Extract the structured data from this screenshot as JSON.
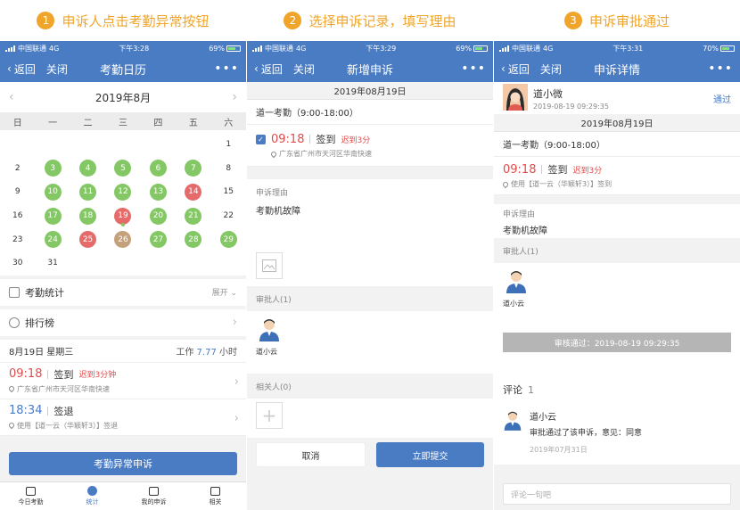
{
  "steps": [
    {
      "num": "1",
      "title": "申诉人点击考勤异常按钮"
    },
    {
      "num": "2",
      "title": "选择申诉记录，填写理由"
    },
    {
      "num": "3",
      "title": "申诉审批通过"
    }
  ],
  "colors": {
    "accent": "#4a7cc4",
    "step": "#f0a52a",
    "late": "#e24b4b",
    "green": "#84c765",
    "red": "#e56b6b",
    "tan": "#c4a07b"
  },
  "status": {
    "carrier": "中国联通",
    "network": "4G",
    "battery1": "69%",
    "battery2": "69%",
    "battery3": "70%",
    "time1": "下午3:28",
    "time2": "下午3:29",
    "time3": "下午3:31"
  },
  "nav": {
    "back": "返回",
    "close": "关闭",
    "more": "•••",
    "title1": "考勤日历",
    "title2": "新增申诉",
    "title3": "申诉详情"
  },
  "calendar": {
    "month": "2019年8月",
    "weekdays": [
      "日",
      "一",
      "二",
      "三",
      "四",
      "五",
      "六"
    ],
    "cells": [
      {
        "d": "",
        "s": ""
      },
      {
        "d": "",
        "s": ""
      },
      {
        "d": "",
        "s": ""
      },
      {
        "d": "",
        "s": ""
      },
      {
        "d": "",
        "s": ""
      },
      {
        "d": "",
        "s": ""
      },
      {
        "d": "1",
        "s": ""
      },
      {
        "d": "2",
        "s": ""
      },
      {
        "d": "3",
        "s": "g"
      },
      {
        "d": "4",
        "s": "g"
      },
      {
        "d": "5",
        "s": "g"
      },
      {
        "d": "6",
        "s": "g"
      },
      {
        "d": "7",
        "s": "g"
      },
      {
        "d": "8",
        "s": ""
      },
      {
        "d": "9",
        "s": ""
      },
      {
        "d": "10",
        "s": "g"
      },
      {
        "d": "11",
        "s": "g"
      },
      {
        "d": "12",
        "s": "g"
      },
      {
        "d": "13",
        "s": "g"
      },
      {
        "d": "14",
        "s": "r"
      },
      {
        "d": "15",
        "s": ""
      },
      {
        "d": "16",
        "s": ""
      },
      {
        "d": "17",
        "s": "g"
      },
      {
        "d": "18",
        "s": "g"
      },
      {
        "d": "19",
        "s": "rs"
      },
      {
        "d": "20",
        "s": "g"
      },
      {
        "d": "21",
        "s": "g"
      },
      {
        "d": "22",
        "s": ""
      },
      {
        "d": "23",
        "s": ""
      },
      {
        "d": "24",
        "s": "g"
      },
      {
        "d": "25",
        "s": "r"
      },
      {
        "d": "26",
        "s": "b"
      },
      {
        "d": "27",
        "s": "g"
      },
      {
        "d": "28",
        "s": "g"
      },
      {
        "d": "29",
        "s": "g"
      },
      {
        "d": "30",
        "s": ""
      },
      {
        "d": "31",
        "s": ""
      }
    ]
  },
  "s1": {
    "stats_label": "考勤统计",
    "expand": "展开",
    "rank_label": "排行榜",
    "date": "8月19日 星期三",
    "work_prefix": "工作",
    "work_hours": "7.77",
    "work_unit": "小时",
    "in_time": "09:18",
    "in_label": "签到",
    "in_status": "迟到3分钟",
    "in_loc": "广东省广州市天河区华南快速",
    "out_time": "18:34",
    "out_label": "签退",
    "out_loc": "使用【道一云（华颖轩3）】签退",
    "button": "考勤异常申诉",
    "tabs": [
      "今日考勤",
      "统计",
      "我的申诉",
      "相关"
    ]
  },
  "s2": {
    "date": "2019年08月19日",
    "shift": "道一考勤（9:00-18:00）",
    "time": "09:18",
    "label": "签到",
    "status": "迟到3分",
    "loc": "广东省广州市天河区华南快速",
    "reason_label": "申诉理由",
    "reason": "考勤机故障",
    "approver_label": "审批人(1)",
    "approver": "道小云",
    "related_label": "相关人(0)",
    "cancel": "取消",
    "submit": "立即提交"
  },
  "s3": {
    "user": "道小微",
    "user_time": "2019-08-19 09:29:35",
    "approved": "通过",
    "date": "2019年08月19日",
    "shift": "道一考勤（9:00-18:00）",
    "time": "09:18",
    "label": "签到",
    "status": "迟到3分",
    "loc": "使用【道一云（华颖轩3）】签到",
    "reason_label": "申诉理由",
    "reason": "考勤机故障",
    "approver_label": "审批人(1)",
    "approver": "道小云",
    "audit": "审核通过：2019-08-19 09:29:35",
    "comment_label": "评论",
    "comment_count": "1",
    "c_name": "道小云",
    "c_text": "审批通过了该申诉，意见：同意",
    "c_date": "2019年07月31日",
    "input_ph": "评论一句吧"
  }
}
